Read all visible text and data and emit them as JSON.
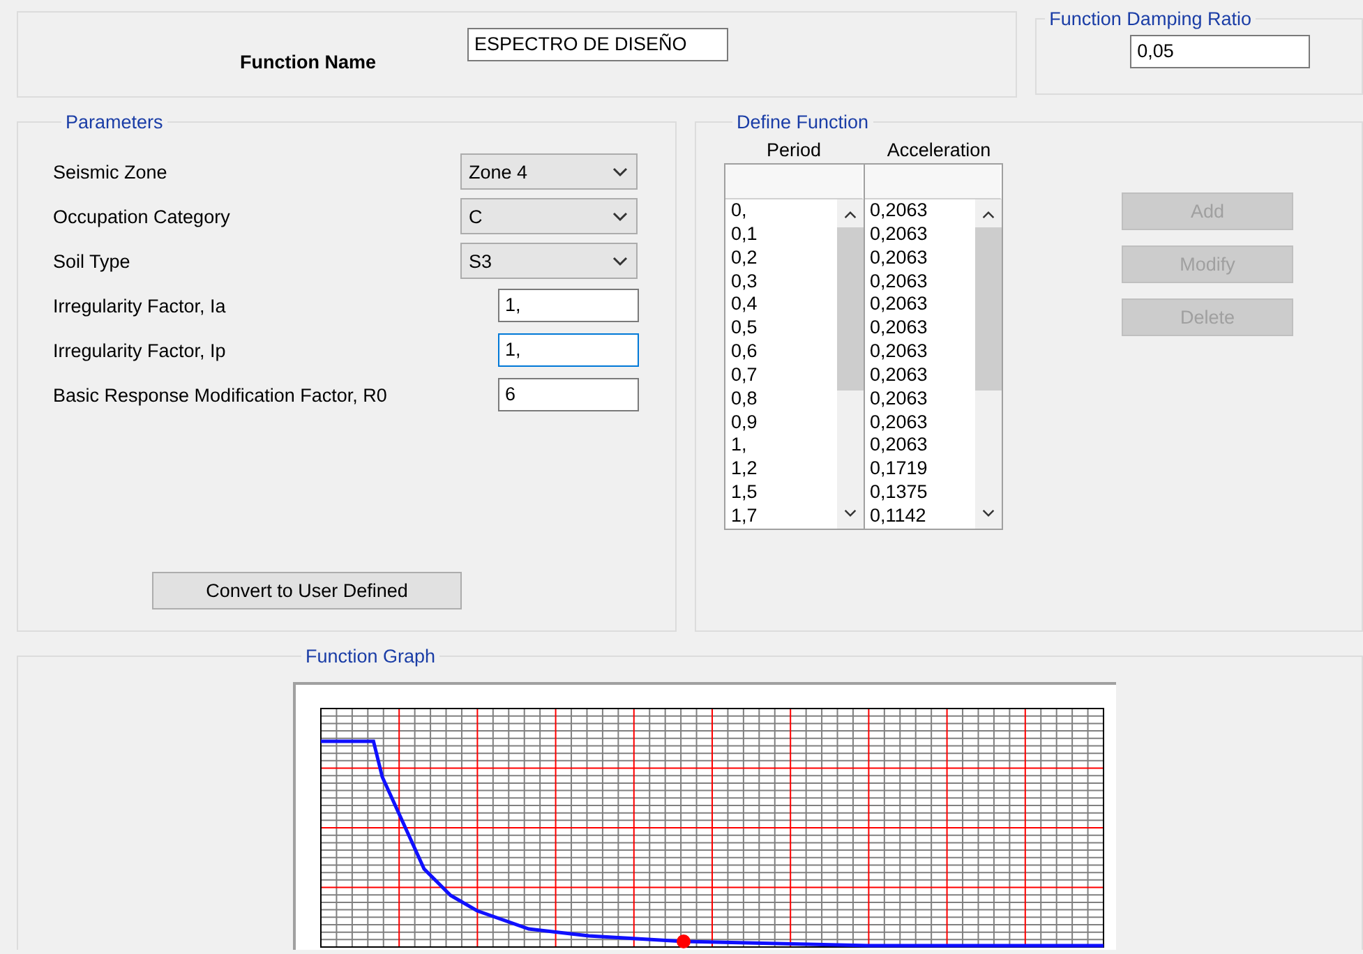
{
  "function_name": {
    "label": "Function Name",
    "value": "ESPECTRO DE DISEÑO"
  },
  "damping": {
    "title": "Function Damping Ratio",
    "value": "0,05"
  },
  "parameters": {
    "title": "Parameters",
    "rows": [
      {
        "kind": "dropdown",
        "label": "Seismic Zone",
        "value": "Zone 4"
      },
      {
        "kind": "dropdown",
        "label": "Occupation Category",
        "value": "C"
      },
      {
        "kind": "dropdown",
        "label": "Soil Type",
        "value": "S3"
      },
      {
        "kind": "text",
        "label": "Irregularity Factor, Ia",
        "value": "1,",
        "focused": false
      },
      {
        "kind": "text",
        "label": "Irregularity Factor, Ip",
        "value": "1,",
        "focused": true
      },
      {
        "kind": "text",
        "label": "Basic Response Modification Factor, R0",
        "value": "6",
        "focused": false
      }
    ],
    "convert_button": "Convert to User Defined"
  },
  "define_function": {
    "title": "Define Function",
    "columns": [
      "Period",
      "Acceleration"
    ],
    "rows": [
      [
        "0,",
        "0,2063"
      ],
      [
        "0,1",
        "0,2063"
      ],
      [
        "0,2",
        "0,2063"
      ],
      [
        "0,3",
        "0,2063"
      ],
      [
        "0,4",
        "0,2063"
      ],
      [
        "0,5",
        "0,2063"
      ],
      [
        "0,6",
        "0,2063"
      ],
      [
        "0,7",
        "0,2063"
      ],
      [
        "0,8",
        "0,2063"
      ],
      [
        "0,9",
        "0,2063"
      ],
      [
        "1,",
        "0,2063"
      ],
      [
        "1,2",
        "0,1719"
      ],
      [
        "1,5",
        "0,1375"
      ],
      [
        "1,7",
        "0,1142"
      ]
    ],
    "buttons": [
      {
        "label": "Add",
        "disabled": true
      },
      {
        "label": "Modify",
        "disabled": true
      },
      {
        "label": "Delete",
        "disabled": true
      }
    ]
  },
  "graph": {
    "title": "Function Graph"
  }
}
